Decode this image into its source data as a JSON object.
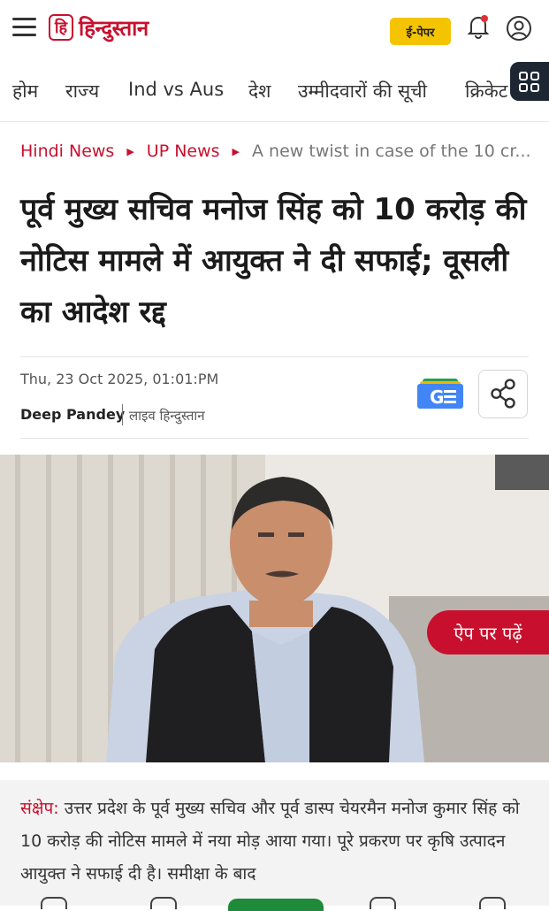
{
  "header": {
    "logo_mark": "हि",
    "logo_text": "हिन्दुस्तान",
    "epaper_label": "ई-पेपर",
    "icons": [
      "menu-icon",
      "bell-icon",
      "user-icon"
    ],
    "colors": {
      "brand": "#c8102e",
      "epaper": "#f5c400"
    }
  },
  "nav": {
    "items": [
      "होम",
      "राज्य",
      "Ind vs Aus",
      "देश",
      "उम्मीदवारों की सूची",
      "क्रिकेट"
    ],
    "grid_icon": "grid-icon"
  },
  "breadcrumb": {
    "items": [
      "Hindi News",
      "UP News"
    ],
    "current": "A new twist in case of the 10 cr..."
  },
  "article": {
    "headline": "पूर्व मुख्य सचिव मनोज सिंह को 10 करोड़ की नोटिस मामले में आयुक्त ने दी सफाई; वूसली का आदेश रद्द",
    "date": "Thu, 23 Oct 2025, 01:01:PM",
    "author": "Deep Pandey",
    "source": "लाइव हिन्दुस्तान",
    "app_button": "ऐप पर पढ़ें",
    "summary_label": "संक्षेप:",
    "summary_text": " उत्तर प्रदेश के पूर्व मुख्य सचिव और पूर्व डास्प चेयरमैन मनोज कुमार सिंह को 10 करोड़ की नोटिस मामले में नया मोड़ आया गया। पूरे प्रकरण पर कृषि उत्पादन आयुक्त ने सफाई दी है। समीक्षा के बाद"
  }
}
